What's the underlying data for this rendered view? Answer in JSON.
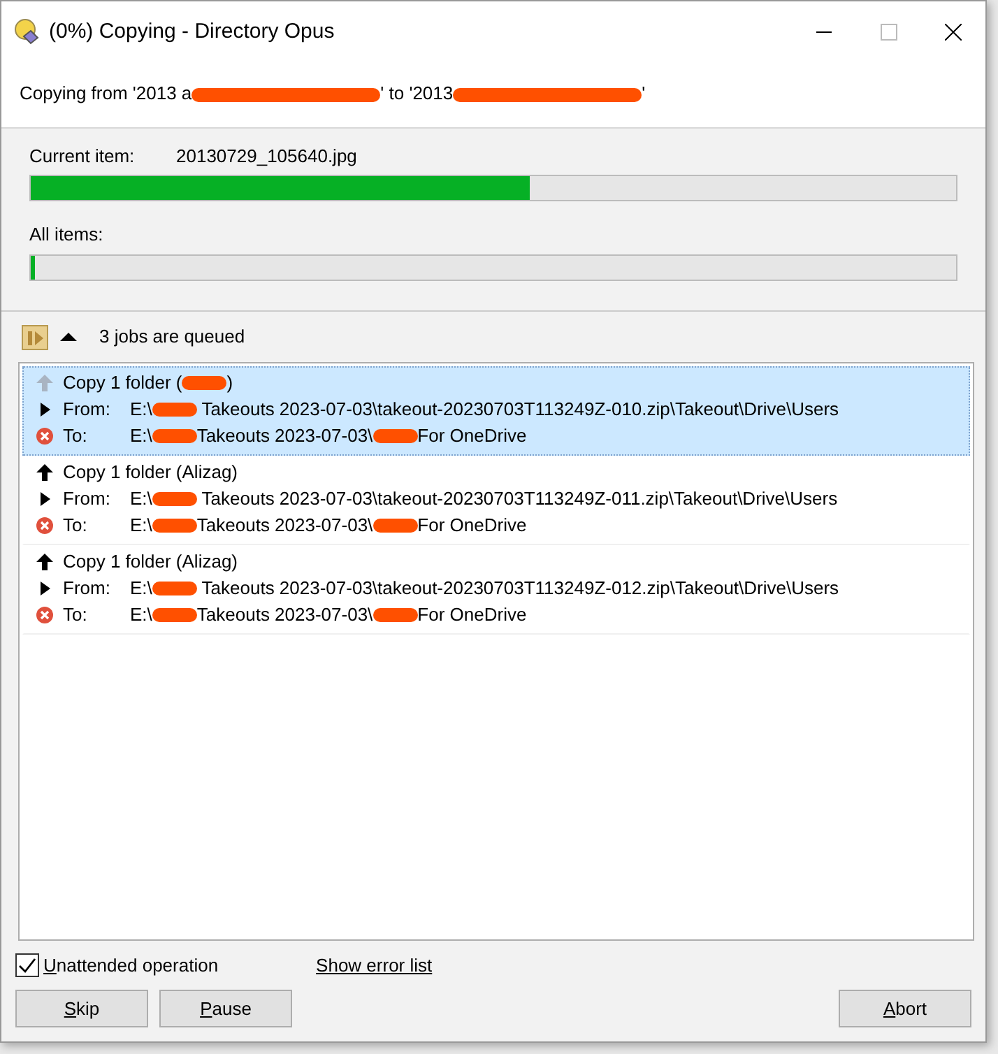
{
  "window": {
    "title": "(0%) Copying - Directory Opus"
  },
  "header": {
    "segments": [
      {
        "kind": "text",
        "text": "Copying from '2013 a"
      },
      {
        "kind": "redaction",
        "long": true
      },
      {
        "kind": "text",
        "text": "' to '2013"
      },
      {
        "kind": "redaction",
        "long": true
      },
      {
        "kind": "text",
        "text": "'"
      }
    ]
  },
  "progress": [
    {
      "label": "Current item:",
      "value": "20130729_105640.jpg",
      "level": 0.54
    },
    {
      "label": "All items:",
      "level": 0.004
    }
  ],
  "queue": {
    "expanded": true,
    "label": "3 jobs are queued"
  },
  "jobs": [
    {
      "selected": true,
      "running": true,
      "title": [
        {
          "kind": "text",
          "text": "Copy 1 folder ("
        },
        {
          "kind": "redaction",
          "long": false
        },
        {
          "kind": "text",
          "text": ")"
        }
      ],
      "lines": [
        {
          "kind": "from",
          "label": "From:",
          "segments": [
            {
              "kind": "text",
              "text": "E:\\"
            },
            {
              "kind": "redaction",
              "long": false
            },
            {
              "kind": "text",
              "text": " Takeouts 2023-07-03\\takeout-20230703T113249Z-010.zip\\Takeout\\Drive\\Users"
            }
          ]
        },
        {
          "kind": "to",
          "label": "To:",
          "segments": [
            {
              "kind": "text",
              "text": "E:\\"
            },
            {
              "kind": "redaction",
              "long": false
            },
            {
              "kind": "text",
              "text": "Takeouts 2023-07-03\\"
            },
            {
              "kind": "redaction",
              "long": false
            },
            {
              "kind": "text",
              "text": "For OneDrive"
            }
          ]
        }
      ]
    },
    {
      "selected": false,
      "running": false,
      "title": [
        {
          "kind": "text",
          "text": "Copy 1 folder (Alizag)"
        }
      ],
      "lines": [
        {
          "kind": "from",
          "label": "From:",
          "segments": [
            {
              "kind": "text",
              "text": "E:\\"
            },
            {
              "kind": "redaction",
              "long": false
            },
            {
              "kind": "text",
              "text": " Takeouts 2023-07-03\\takeout-20230703T113249Z-011.zip\\Takeout\\Drive\\Users"
            }
          ]
        },
        {
          "kind": "to",
          "label": "To:",
          "segments": [
            {
              "kind": "text",
              "text": "E:\\"
            },
            {
              "kind": "redaction",
              "long": false
            },
            {
              "kind": "text",
              "text": "Takeouts 2023-07-03\\"
            },
            {
              "kind": "redaction",
              "long": false
            },
            {
              "kind": "text",
              "text": "For OneDrive"
            }
          ]
        }
      ]
    },
    {
      "selected": false,
      "running": false,
      "title": [
        {
          "kind": "text",
          "text": "Copy 1 folder (Alizag)"
        }
      ],
      "lines": [
        {
          "kind": "from",
          "label": "From:",
          "segments": [
            {
              "kind": "text",
              "text": "E:\\"
            },
            {
              "kind": "redaction",
              "long": false
            },
            {
              "kind": "text",
              "text": " Takeouts 2023-07-03\\takeout-20230703T113249Z-012.zip\\Takeout\\Drive\\Users"
            }
          ]
        },
        {
          "kind": "to",
          "label": "To:",
          "segments": [
            {
              "kind": "text",
              "text": "E:\\"
            },
            {
              "kind": "redaction",
              "long": false
            },
            {
              "kind": "text",
              "text": "Takeouts 2023-07-03\\"
            },
            {
              "kind": "redaction",
              "long": false
            },
            {
              "kind": "text",
              "text": "For OneDrive"
            }
          ]
        }
      ]
    }
  ],
  "footer": {
    "checkbox": {
      "label": "Unattended operation",
      "checked": true,
      "underline_first": true
    },
    "link": "Show error list",
    "buttons": [
      {
        "label": "Skip",
        "underline_first": true,
        "push_right": false
      },
      {
        "label": "Pause",
        "underline_first": true,
        "push_right": false
      },
      {
        "label": "Abort",
        "underline_first": true,
        "push_right": true
      }
    ]
  }
}
